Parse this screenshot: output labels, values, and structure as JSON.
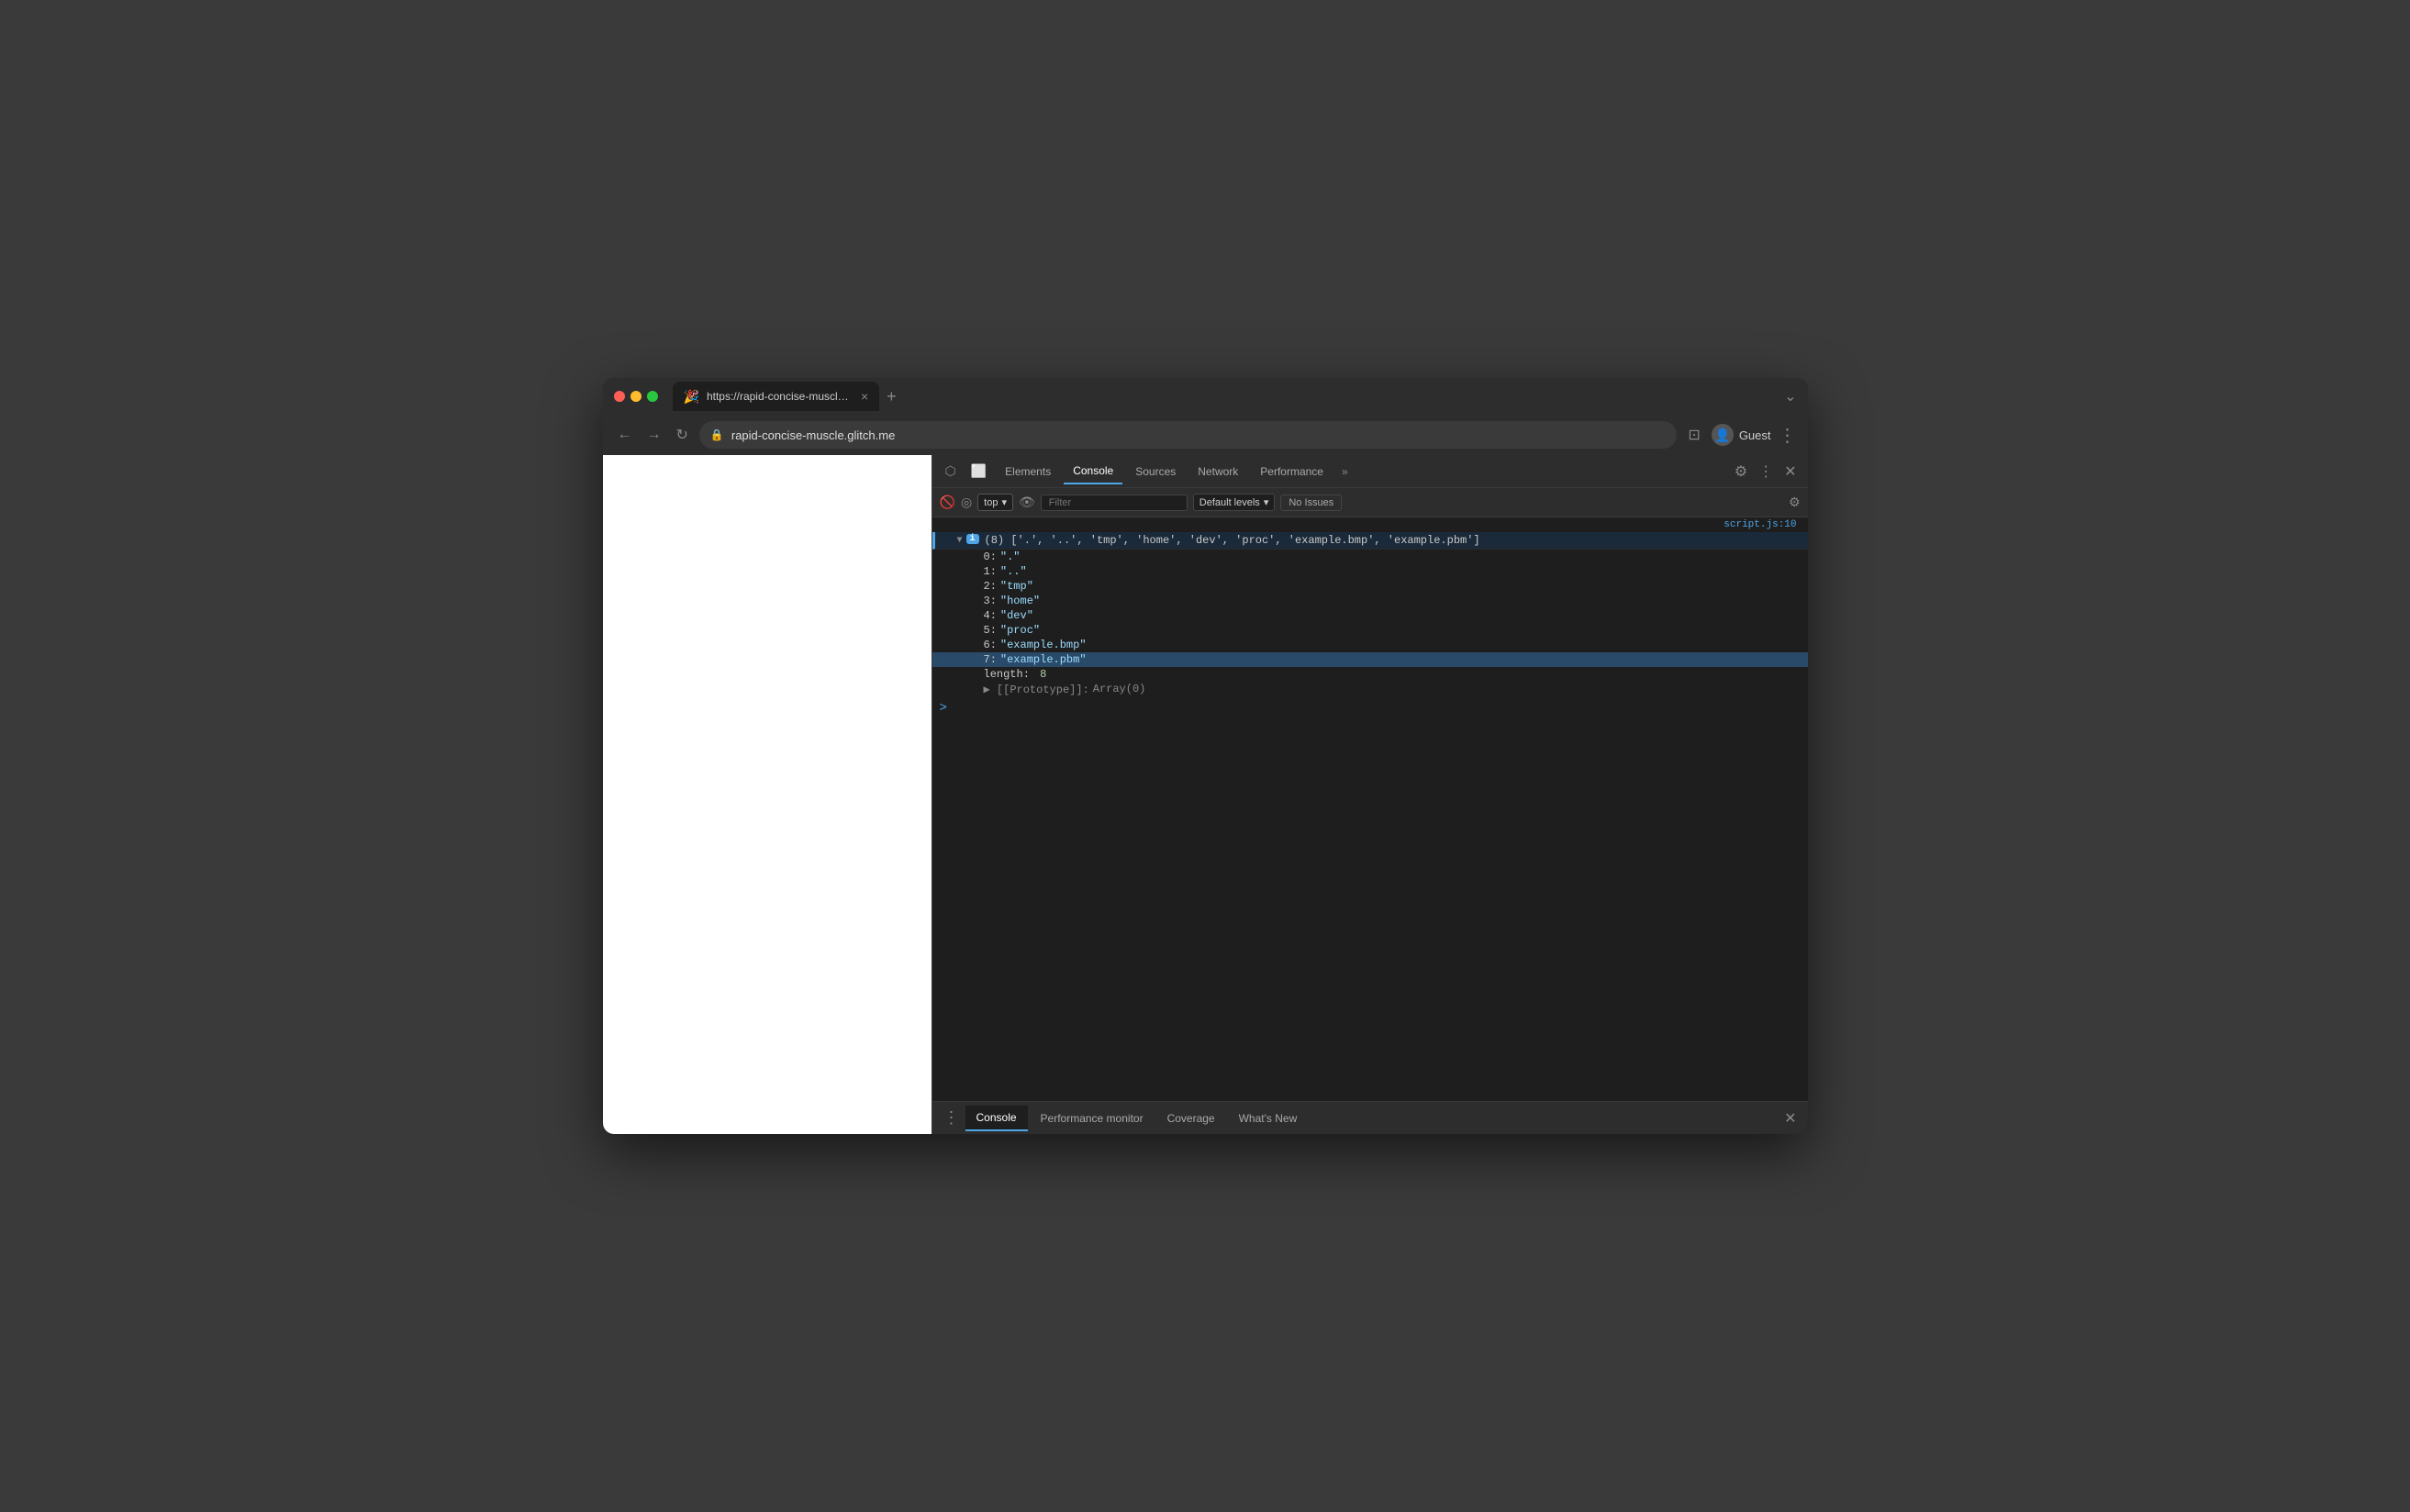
{
  "browser": {
    "tab": {
      "favicon": "🎉",
      "title": "https://rapid-concise-muscle.g...",
      "close_label": "×"
    },
    "new_tab_label": "+",
    "window_controls_label": "⌄",
    "nav": {
      "back_label": "←",
      "forward_label": "→",
      "reload_label": "↻"
    },
    "address": {
      "lock_icon": "🔒",
      "value": "rapid-concise-muscle.glitch.me"
    },
    "devtools_toggle_label": "⊡",
    "profile": {
      "icon": "👤",
      "label": "Guest"
    },
    "more_label": "⋮"
  },
  "devtools": {
    "toolbar": {
      "inspect_label": "⬡",
      "device_label": "⬜",
      "tabs": [
        "Elements",
        "Console",
        "Sources",
        "Network",
        "Performance"
      ],
      "active_tab": "Console",
      "more_label": "»",
      "settings_label": "⚙",
      "more_btn_label": "⋮",
      "close_label": "✕"
    },
    "console": {
      "toolbar": {
        "clear_label": "🚫",
        "no_filter_label": "◎",
        "context": "top",
        "context_arrow": "▾",
        "eye_label": "👁",
        "filter_placeholder": "Filter",
        "log_level": "Default levels",
        "log_level_arrow": "▾",
        "no_issues": "No Issues",
        "settings_label": "⚙"
      },
      "source_file": "script.js:10",
      "array_summary": "(8) ['.', '..', 'tmp', 'home', 'dev', 'proc', 'example.bmp', 'example.pbm']",
      "items": [
        {
          "key": "0:",
          "value": "\".\""
        },
        {
          "key": "1:",
          "value": "\"..\""
        },
        {
          "key": "2:",
          "value": "\"tmp\""
        },
        {
          "key": "3:",
          "value": "\"home\""
        },
        {
          "key": "4:",
          "value": "\"dev\""
        },
        {
          "key": "5:",
          "value": "\"proc\""
        },
        {
          "key": "6:",
          "value": "\"example.bmp\""
        },
        {
          "key": "7:",
          "value": "\"example.pbm\""
        }
      ],
      "length_key": "length:",
      "length_val": "8",
      "prototype_key": "▶ [[Prototype]]:",
      "prototype_val": "Array(0)",
      "prompt_symbol": ">"
    },
    "bottom_bar": {
      "more_label": "⋮",
      "tabs": [
        "Console",
        "Performance monitor",
        "Coverage",
        "What's New"
      ],
      "active_tab": "Console",
      "close_label": "✕"
    }
  }
}
